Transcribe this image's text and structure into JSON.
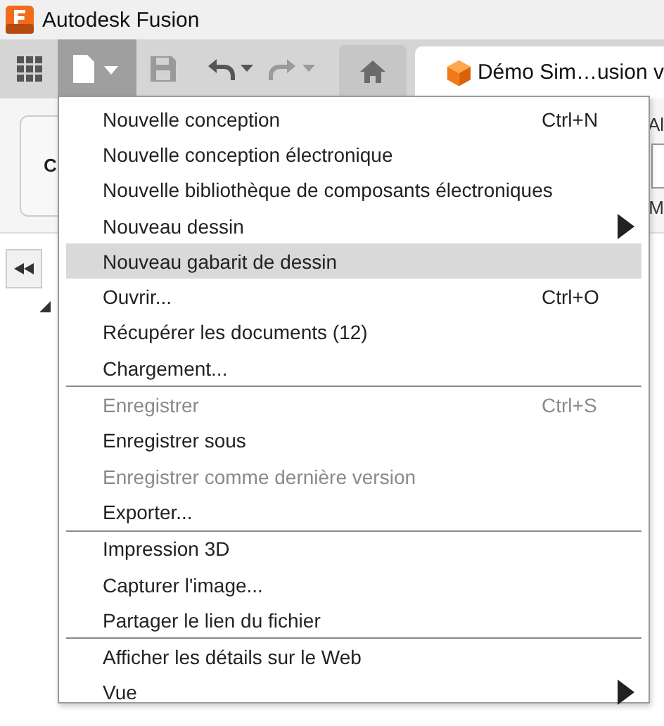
{
  "window": {
    "title": "Autodesk Fusion"
  },
  "toolbar": {
    "document_tab": "Démo Sim…usion v"
  },
  "background": {
    "ribbon_button": "C",
    "ribbon_right_top": "Al",
    "ribbon_right_bottom": "M"
  },
  "file_menu": {
    "sections": [
      [
        {
          "label": "Nouvelle conception",
          "shortcut": "Ctrl+N",
          "submenu": false,
          "disabled": false,
          "selected": false
        },
        {
          "label": "Nouvelle conception électronique",
          "submenu": false,
          "disabled": false,
          "selected": false
        },
        {
          "label": "Nouvelle bibliothèque de composants électroniques",
          "submenu": false,
          "disabled": false,
          "selected": false
        },
        {
          "label": "Nouveau dessin",
          "submenu": true,
          "disabled": false,
          "selected": false
        },
        {
          "label": "Nouveau gabarit de dessin",
          "submenu": false,
          "disabled": false,
          "selected": true
        },
        {
          "label": "Ouvrir...",
          "shortcut": "Ctrl+O",
          "submenu": false,
          "disabled": false,
          "selected": false
        },
        {
          "label": "Récupérer les documents (12)",
          "submenu": false,
          "disabled": false,
          "selected": false
        },
        {
          "label": "Chargement...",
          "submenu": false,
          "disabled": false,
          "selected": false
        }
      ],
      [
        {
          "label": "Enregistrer",
          "shortcut": "Ctrl+S",
          "submenu": false,
          "disabled": true,
          "selected": false
        },
        {
          "label": "Enregistrer sous",
          "submenu": false,
          "disabled": false,
          "selected": false
        },
        {
          "label": "Enregistrer comme dernière version",
          "submenu": false,
          "disabled": true,
          "selected": false
        },
        {
          "label": "Exporter...",
          "submenu": false,
          "disabled": false,
          "selected": false
        }
      ],
      [
        {
          "label": "Impression 3D",
          "submenu": false,
          "disabled": false,
          "selected": false
        },
        {
          "label": "Capturer l'image...",
          "submenu": false,
          "disabled": false,
          "selected": false
        },
        {
          "label": "Partager le lien du fichier",
          "submenu": false,
          "disabled": false,
          "selected": false
        }
      ],
      [
        {
          "label": "Afficher les détails sur le Web",
          "submenu": false,
          "disabled": false,
          "selected": false
        },
        {
          "label": "Vue",
          "submenu": true,
          "disabled": false,
          "selected": false
        }
      ]
    ]
  }
}
